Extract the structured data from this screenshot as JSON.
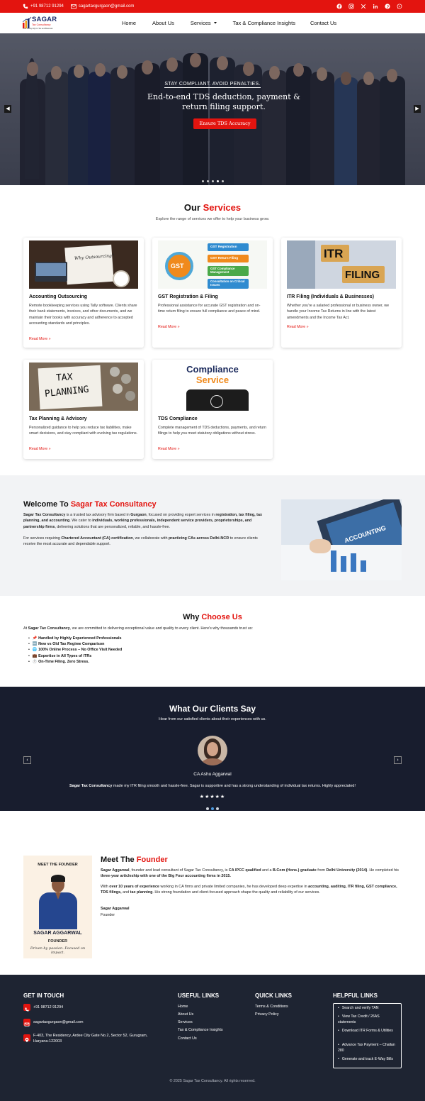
{
  "topbar": {
    "phone": "+91 98712 91294",
    "email": "sagartaxgurgaon@gmail.com",
    "social_icons": [
      "facebook-icon",
      "instagram-icon",
      "x-icon",
      "linkedin-icon",
      "pinterest-icon",
      "whatsapp-icon"
    ]
  },
  "brand": {
    "name": "SAGAR",
    "line2": "Tax Consultancy",
    "tagline": "Your Trusty Ally for Tax and Business",
    "accent": "#e3140f"
  },
  "nav": {
    "items": [
      "Home",
      "About Us",
      "Services",
      "Tax & Compliance Insights",
      "Contact Us"
    ]
  },
  "hero": {
    "kicker": "STAY COMPLIANT. AVOID PENALTIES.",
    "title": "End-to-end TDS deduction, payment & return filing support.",
    "button": "Ensure TDS Accuracy",
    "slide_count": 5,
    "active_slide": 4
  },
  "services": {
    "title_plain": "Our",
    "title_accent": "Services",
    "subtitle": "Explore the range of services we offer to help your business grow.",
    "read_more": "Read More »",
    "cards": [
      {
        "title": "Accounting Outsourcing",
        "desc": "Remote bookkeeping services using Tally software. Clients share their bank statements, invoices, and other documents, and we maintain their books with accuracy and adherence to accepted accounting standards and principles.",
        "img_text": "Why Outsourcing?"
      },
      {
        "title": "GST Registration & Filing",
        "desc": "Professional assistance for accurate GST registration and on-time return filing to ensure full compliance and peace of mind.",
        "img_items": [
          "GST Registration",
          "GST Return Filing",
          "GST Compliance Management",
          "Consultation on Critical Issues"
        ],
        "img_badge": "GST"
      },
      {
        "title": "ITR Filing (Individuals & Businesses)",
        "desc": "Whether you're a salaried professional or business owner, we handle your Income Tax Returns in line with the latest amendments and the Income Tax Act.",
        "img_line1": "ITR",
        "img_line2": "FILING"
      },
      {
        "title": "Tax Planning & Advisory",
        "desc": "Personalized guidance to help you reduce tax liabilities, make smart decisions, and stay compliant with evolving tax regulations.",
        "img_line1": "TAX",
        "img_line2": "PLANNING"
      },
      {
        "title": "TDS Compliance",
        "desc": "Complete management of TDS deductions, payments, and return filings to help you meet statutory obligations without stress.",
        "img_line1": "Compliance",
        "img_line2": "Service"
      }
    ]
  },
  "welcome": {
    "title_plain": "Welcome To",
    "title_accent": "Sagar Tax Consultancy",
    "img_text": "ACCOUNTING",
    "p1": [
      {
        "t": "Sagar Tax Consultancy",
        "b": true
      },
      {
        "t": " is a trusted tax advisory firm based in ",
        "b": false
      },
      {
        "t": "Gurgaon",
        "b": true
      },
      {
        "t": ", focused on providing expert services in ",
        "b": false
      },
      {
        "t": "registration, tax filing, tax planning, and accounting",
        "b": true
      },
      {
        "t": ". We cater to ",
        "b": false
      },
      {
        "t": "individuals, working professionals, independent service providers, proprietorships, and partnership firms",
        "b": true
      },
      {
        "t": ", delivering solutions that are personalized, reliable, and hassle-free.",
        "b": false
      }
    ],
    "p2": [
      {
        "t": "For services requiring ",
        "b": false
      },
      {
        "t": "Chartered Accountant (CA) certification",
        "b": true
      },
      {
        "t": ", we collaborate with ",
        "b": false
      },
      {
        "t": "practicing CAs across Delhi-NCR",
        "b": true
      },
      {
        "t": " to ensure clients receive the most accurate and dependable support.",
        "b": false
      }
    ]
  },
  "why": {
    "title_plain": "Why",
    "title_accent": "Choose Us",
    "intro_pre": "At ",
    "intro_bold": "Sagar Tax Consultancy",
    "intro_post": ", we are committed to delivering exceptional value and quality to every client. Here's why thousands trust us:",
    "items": [
      "📌 Handled by Highly Experienced Professionals",
      "🆕 New vs Old Tax Regime Comparison",
      "🌐 100% Online Process – No Office Visit Needed",
      "💼 Expertise in All Types of ITRs",
      "⏱️ On-Time Filing. Zero Stress."
    ]
  },
  "testimonials": {
    "title": "What Our Clients Say",
    "subtitle": "Hear from our satisfied clients about their experiences with us.",
    "name": "CA Ashu Aggarwal",
    "quote_bold": "Sagar Tax Consultancy",
    "quote_rest": " made my ITR filing smooth and hassle-free. Sagar is supportive and has a strong understanding of individual tax returns. Highly appreciated!",
    "rating": 5,
    "stars": "★★★★★",
    "slide_count": 3,
    "active_slide": 2
  },
  "founder": {
    "card_label": "MEET THE FOUNDER",
    "card_name": "SAGAR AGGARWAL",
    "card_role": "FOUNDER",
    "card_tagline": "Driven by passion. Focused on impact.",
    "title_plain": "Meet The",
    "title_accent": "Founder",
    "p1": [
      {
        "t": "Sagar Aggarwal",
        "b": true
      },
      {
        "t": ", founder and lead consultant of Sagar Tax Consultancy, is ",
        "b": false
      },
      {
        "t": "CA IPCC qualified",
        "b": true
      },
      {
        "t": " and a ",
        "b": false
      },
      {
        "t": "B.Com (Hons.) graduate",
        "b": true
      },
      {
        "t": " from ",
        "b": false
      },
      {
        "t": "Delhi University (2014)",
        "b": true
      },
      {
        "t": ". He completed his ",
        "b": false
      },
      {
        "t": "three-year articleship with one of the Big Four accounting firms in 2015.",
        "b": true
      }
    ],
    "p2": [
      {
        "t": "With ",
        "b": false
      },
      {
        "t": "over 10 years of experience",
        "b": true
      },
      {
        "t": " working in CA firms and private limited companies, he has developed deep expertise in ",
        "b": false
      },
      {
        "t": "accounting, auditing, ITR filing, GST compliance, TDS filings,",
        "b": true
      },
      {
        "t": " and ",
        "b": false
      },
      {
        "t": "tax planning",
        "b": true
      },
      {
        "t": ". His strong foundation and client-focused approach shape the quality and reliability of our services.",
        "b": false
      }
    ],
    "sign_name": "Sagar Aggarwal",
    "sign_role": "Founder"
  },
  "footer": {
    "contact_title": "GET IN TOUCH",
    "phone": "+91 98712 91294",
    "email": "sagartaxgurgaon@gmail.com",
    "address": "F-403, The Residency, Ardee City Gate No.2, Sector 52, Gurugram, Haryana-122003",
    "useful_title": "USEFUL LINKS",
    "useful_links": [
      "Home",
      "About Us",
      "Services",
      "Tax & Compliance Insights",
      "Contact Us"
    ],
    "quick_title": "QUICK LINKS",
    "quick_links": [
      "Terms & Conditions",
      "Privacy Policy"
    ],
    "helpful_title": "HELPFUL LINKS",
    "helpful_links": [
      "Search and verify TAN",
      "View Tax Credit / 26AS statements",
      "Download ITR Forms & Utilities",
      "Advance Tax Payment – Challan 280",
      "Generate and track E-Way Bills"
    ],
    "copyright": "© 2025 Sagar Tax Consultancy. All rights reserved."
  }
}
